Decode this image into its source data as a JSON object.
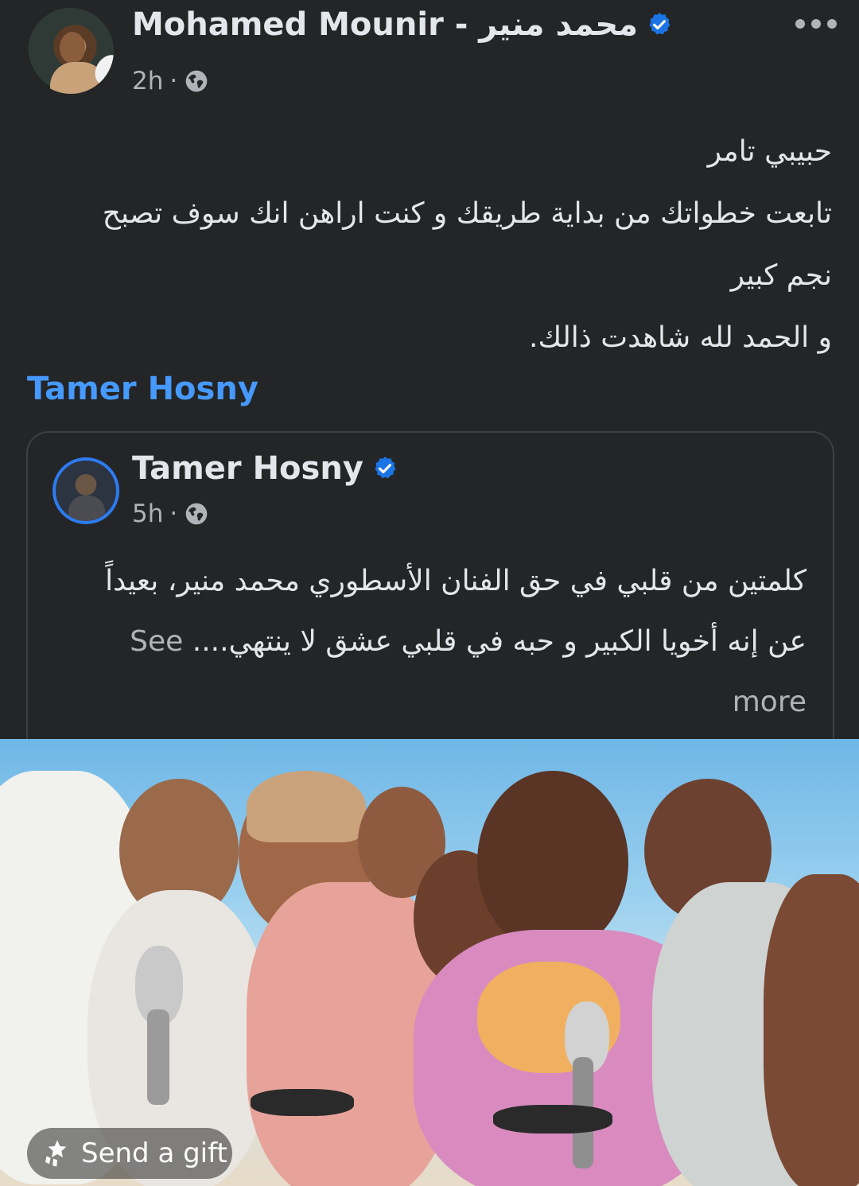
{
  "post": {
    "author": "Mohamed Mounir - محمد منير",
    "time": "2h",
    "separator": "·",
    "privacy_icon": "globe-icon",
    "menu_icon": "more-dots-icon",
    "text_lines": [
      "حبيبي تامر",
      "تابعت خطواتك من بداية طريقك و كنت اراهن انك سوف تصبح",
      "نجم كبير",
      "و الحمد لله شاهدت ذالك."
    ],
    "mention": "Tamer Hosny"
  },
  "shared": {
    "author": "Tamer Hosny",
    "time": "5h",
    "separator": "·",
    "text": "كلمتين من قلبي في حق الفنان الأسطوري محمد منير، بعيداً عن إنه أخويا الكبير و حبه في قلبي عشق لا ينتهي....",
    "see_more": "See more"
  },
  "gift": {
    "label": "Send a gift",
    "icon": "gift-icon"
  },
  "colors": {
    "background": "#242526",
    "text": "#e4e6eb",
    "secondary": "#b0b3b8",
    "link": "#4599ff",
    "verified": "#1b74e4"
  }
}
